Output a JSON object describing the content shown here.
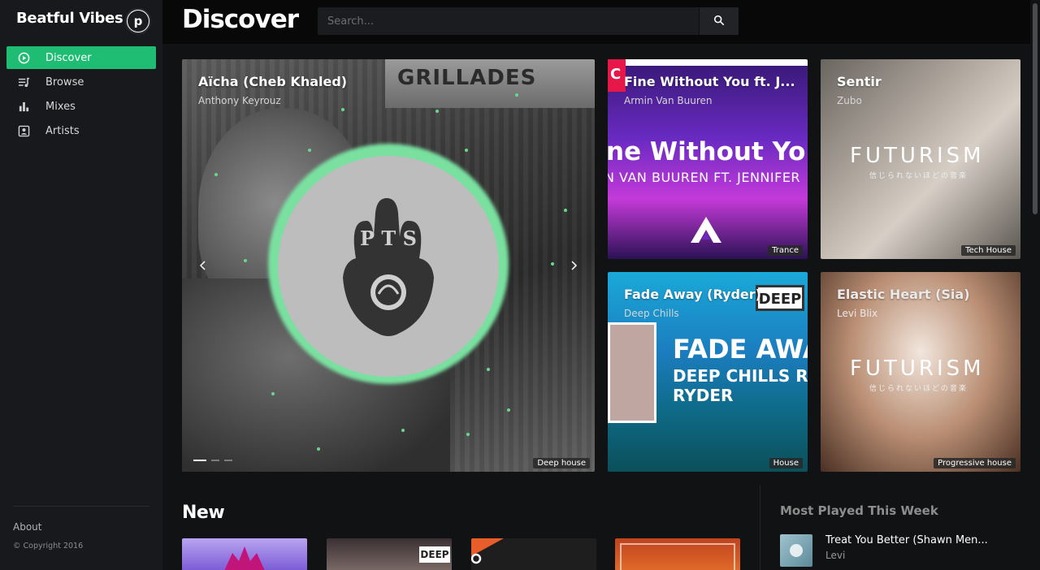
{
  "app": {
    "brand": "Beatful Vibes",
    "logo_letter": "p"
  },
  "sidebar": {
    "items": [
      {
        "label": "Discover",
        "icon": "play-circle-icon",
        "active": true
      },
      {
        "label": "Browse",
        "icon": "queue-music-icon",
        "active": false
      },
      {
        "label": "Mixes",
        "icon": "bar-chart-icon",
        "active": false
      },
      {
        "label": "Artists",
        "icon": "account-box-icon",
        "active": false
      }
    ],
    "footer": {
      "about": "About",
      "copyright": "© Copyright 2016"
    }
  },
  "header": {
    "title": "Discover"
  },
  "search": {
    "placeholder": "Search..."
  },
  "featured": {
    "hero": {
      "title": "Aïcha (Cheb Khaled)",
      "artist": "Anthony Keyrouz",
      "genre": "Deep house",
      "awning_text": "GRILLADES"
    },
    "cards": [
      {
        "title": "Fine Without You ft. J...",
        "artist": "Armin Van Buuren",
        "genre": "Trance",
        "art_big": "ne Without Yo",
        "art_sub": "N VAN BUUREN FT. JENNIFER",
        "art_badge": "C"
      },
      {
        "title": "Sentir",
        "artist": "Zubo",
        "genre": "Tech House",
        "art_big": "FUTURISM",
        "art_small": "信じられないほどの音楽"
      },
      {
        "title": "Fade Away (Ryder)",
        "artist": "Deep Chills",
        "genre": "House",
        "art_big": "FADE AWA",
        "art_mid": "DEEP CHILLS REM",
        "art_mid2": "RYDER",
        "art_badge": "DEEP"
      },
      {
        "title": "Elastic Heart (Sia)",
        "artist": "Levi Blix",
        "genre": "Progressive house",
        "art_big": "FUTURISM",
        "art_small": "信じられないほどの音楽"
      }
    ]
  },
  "new_section": {
    "title": "New"
  },
  "most_played": {
    "title": "Most Played This Week",
    "items": [
      {
        "title": "Treat You Better (Shawn Men...",
        "artist": "Levi"
      }
    ]
  },
  "colors": {
    "accent": "#1fbd73",
    "sidebar_bg": "#18191c",
    "page_bg": "#111214",
    "visualizer": "#7ae0a0"
  }
}
